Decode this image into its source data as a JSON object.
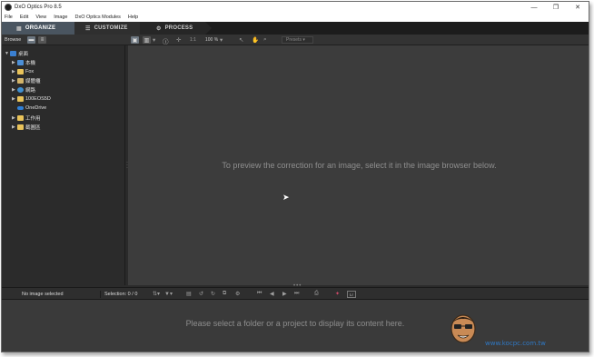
{
  "window": {
    "title": "DxO Optics Pro 8.5"
  },
  "window_controls": {
    "minimize": "—",
    "maximize": "❐",
    "close": "✕"
  },
  "menu": [
    "File",
    "Edit",
    "View",
    "Image",
    "DxO Optics Modules",
    "Help"
  ],
  "tabs": [
    {
      "label": "ORGANIZE",
      "icon": "grid-icon",
      "glyph": "▦"
    },
    {
      "label": "CUSTOMIZE",
      "icon": "sliders-icon",
      "glyph": "☰"
    },
    {
      "label": "PROCESS",
      "icon": "gear-icon",
      "glyph": "⚙"
    }
  ],
  "toolbar": {
    "browse_label": "Browse",
    "ratio": "1:1",
    "zoom": "100 %",
    "presets": "Presets"
  },
  "tree": [
    {
      "label": "桌面",
      "icon": "desktop-icon",
      "expanded": true
    },
    {
      "label": "本機",
      "icon": "computer-icon"
    },
    {
      "label": "Fox",
      "icon": "folder-icon"
    },
    {
      "label": "媒體櫃",
      "icon": "library-icon"
    },
    {
      "label": "網路",
      "icon": "network-icon"
    },
    {
      "label": "100EOS5D",
      "icon": "folder-icon"
    },
    {
      "label": "OneDrive",
      "icon": "cloud-icon"
    },
    {
      "label": "工作用",
      "icon": "folder-icon"
    },
    {
      "label": "截圖區",
      "icon": "folder-icon"
    }
  ],
  "viewer": {
    "message": "To preview the correction for an image, select it in the image browser below."
  },
  "statusbar": {
    "no_image": "No image selected",
    "selection": "Selection: 0 / 0",
    "lr_badge": "Lr"
  },
  "filmstrip": {
    "message": "Please select a folder or a project to display its content here."
  },
  "watermark": {
    "text": "www.kocpc.com.tw"
  },
  "colors": {
    "accent_tab": "#4a5560",
    "viewer_bg": "#3c3c3c",
    "watermark": "#2f78c4"
  }
}
